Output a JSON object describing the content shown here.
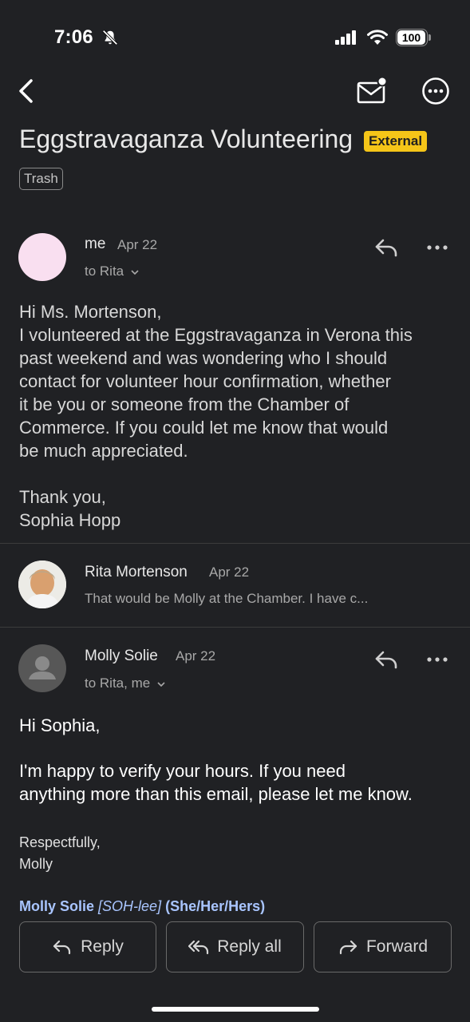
{
  "status_bar": {
    "time": "7:06",
    "battery": "100"
  },
  "email": {
    "subject": "Eggstravaganza Volunteering",
    "external_label": "External",
    "folder_label": "Trash"
  },
  "messages": [
    {
      "sender": "me",
      "date": "Apr 22",
      "recipients": "to Rita",
      "body_lines": [
        "Hi Ms. Mortenson,",
        "I volunteered at the Eggstravaganza in Verona this",
        "past weekend and was wondering who I should",
        "contact for volunteer hour confirmation, whether",
        "it be you or someone from the Chamber of",
        "Commerce. If you could let me know that would",
        "be much appreciated.",
        "",
        "Thank you,",
        "Sophia Hopp"
      ]
    },
    {
      "sender": "Rita Mortenson",
      "date": "Apr 22",
      "snippet": "That would be Molly at the Chamber. I have c..."
    },
    {
      "sender": "Molly Solie",
      "date": "Apr 22",
      "recipients": "to Rita, me",
      "greeting": "Hi Sophia,",
      "body_lines": [
        "I'm happy to verify your hours. If you need",
        "anything more than this email, please let me know."
      ],
      "closing": [
        "Respectfully,",
        "Molly"
      ],
      "signature": {
        "name": "Molly Solie",
        "pronunciation": "[SOH-lee]",
        "pronouns": "(She/Her/Hers)"
      }
    }
  ],
  "actions": {
    "reply": "Reply",
    "reply_all": "Reply all",
    "forward": "Forward"
  },
  "colors": {
    "background": "#202124",
    "external_badge": "#f5c518",
    "signature_link": "#a9c5ff"
  }
}
